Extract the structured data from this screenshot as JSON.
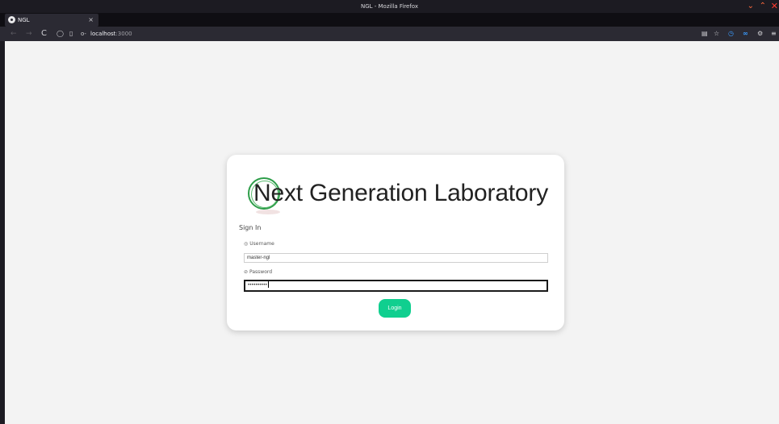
{
  "window": {
    "title": "NGL - Mozilla Firefox"
  },
  "tab": {
    "label": "NGL",
    "close": "×",
    "new_tab": "+"
  },
  "nav": {
    "back": "←",
    "forward": "→",
    "reload": "C",
    "url_host": "localhost",
    "url_port": ":3000"
  },
  "toolbar": {
    "reader": "▤",
    "star": "☆",
    "clock": "◷",
    "infinity": "∞",
    "ext": "⚙",
    "menu": "≡"
  },
  "app": {
    "logo_text": "Next Generation Laboratory",
    "heading": "Sign In",
    "username_label": "Username",
    "username_value": "master-ngl",
    "password_label": "Password",
    "password_value": "••••••••••",
    "login_label": "Login"
  },
  "colors": {
    "accent": "#10cf8f",
    "logo_green": "#2e9e4a"
  }
}
